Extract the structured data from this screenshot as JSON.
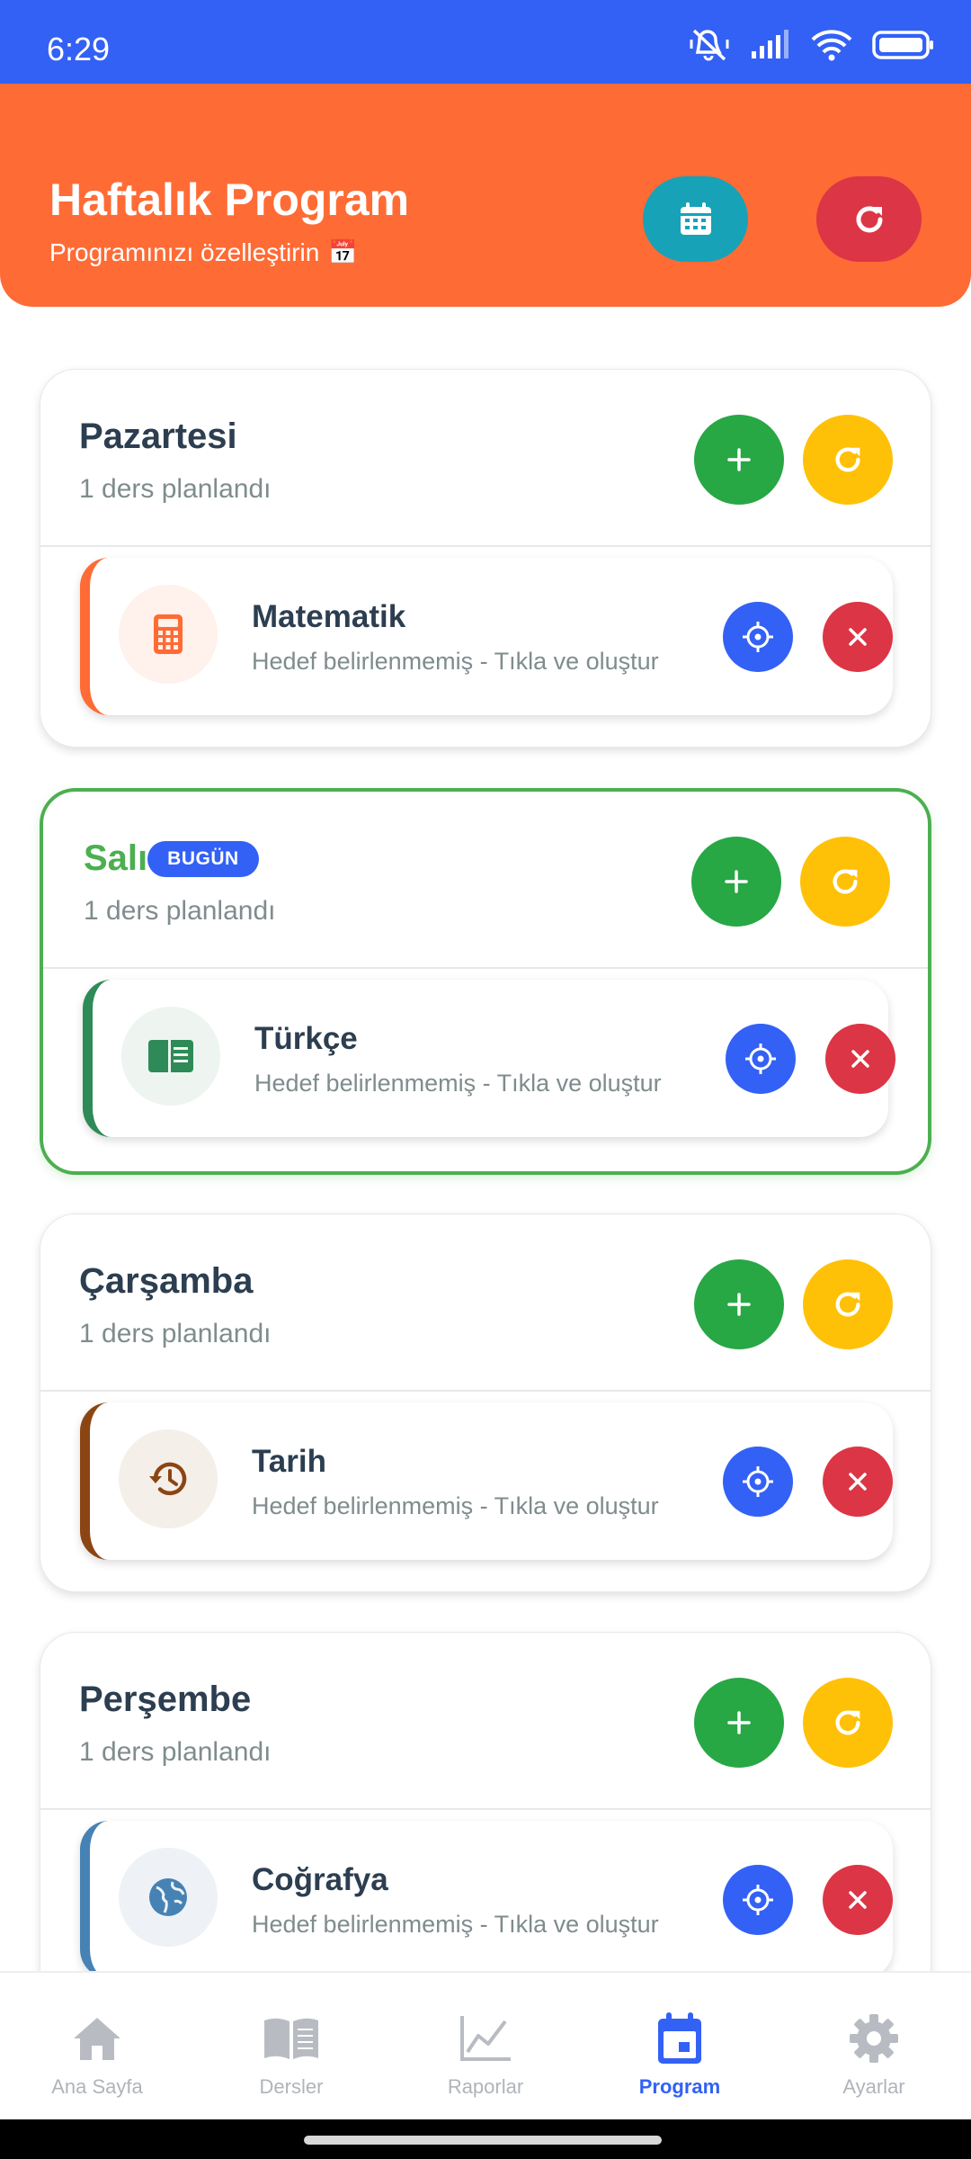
{
  "status_bar": {
    "time": "6:29"
  },
  "header": {
    "title": "Haftalık Program",
    "subtitle": "Programınızı özelleştirin",
    "subtitle_emoji": "📅"
  },
  "days": [
    {
      "name": "Pazartesi",
      "count": "1 ders planlandı",
      "lesson": {
        "name": "Matematik",
        "subtitle": "Hedef belirlenmemiş - Tıkla ve oluştur",
        "icon": "calculator-icon",
        "accent": "#ff6b35"
      }
    },
    {
      "name": "Salı",
      "badge": "BUGÜN",
      "count": "1 ders planlandı",
      "lesson": {
        "name": "Türkçe",
        "subtitle": "Hedef belirlenmemiş - Tıkla ve oluştur",
        "icon": "book-open-icon",
        "accent": "#2e8b57"
      }
    },
    {
      "name": "Çarşamba",
      "count": "1 ders planlandı",
      "lesson": {
        "name": "Tarih",
        "subtitle": "Hedef belirlenmemiş - Tıkla ve oluştur",
        "icon": "history-icon",
        "accent": "#8b4513"
      }
    },
    {
      "name": "Perşembe",
      "count": "1 ders planlandı",
      "lesson": {
        "name": "Coğrafya",
        "subtitle": "Hedef belirlenmemiş - Tıkla ve oluştur",
        "icon": "globe-icon",
        "accent": "#4682b4"
      }
    }
  ],
  "bottom_nav": [
    {
      "label": "Ana Sayfa",
      "icon": "home-icon"
    },
    {
      "label": "Dersler",
      "icon": "book-icon"
    },
    {
      "label": "Raporlar",
      "icon": "chart-line-icon"
    },
    {
      "label": "Program",
      "icon": "calendar-icon",
      "active": true
    },
    {
      "label": "Ayarlar",
      "icon": "gear-icon"
    }
  ],
  "colors": {
    "primary": "#3361f5",
    "header": "#ff6b35",
    "today": "#4caf50",
    "add": "#28a745",
    "redo": "#ffc107",
    "remove": "#dc3545",
    "calendar_button": "#17a2b8"
  }
}
